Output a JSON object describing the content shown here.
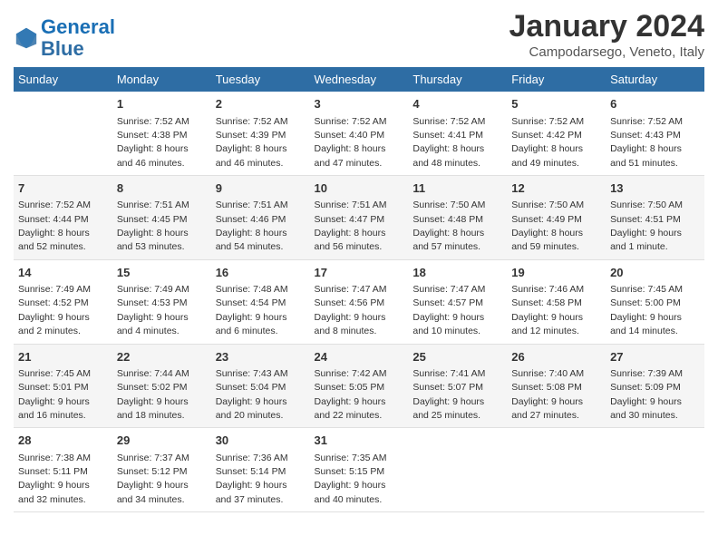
{
  "header": {
    "logo_line1": "General",
    "logo_line2": "Blue",
    "month": "January 2024",
    "location": "Campodarsego, Veneto, Italy"
  },
  "weekdays": [
    "Sunday",
    "Monday",
    "Tuesday",
    "Wednesday",
    "Thursday",
    "Friday",
    "Saturday"
  ],
  "weeks": [
    [
      {
        "day": "",
        "info": ""
      },
      {
        "day": "1",
        "info": "Sunrise: 7:52 AM\nSunset: 4:38 PM\nDaylight: 8 hours\nand 46 minutes."
      },
      {
        "day": "2",
        "info": "Sunrise: 7:52 AM\nSunset: 4:39 PM\nDaylight: 8 hours\nand 46 minutes."
      },
      {
        "day": "3",
        "info": "Sunrise: 7:52 AM\nSunset: 4:40 PM\nDaylight: 8 hours\nand 47 minutes."
      },
      {
        "day": "4",
        "info": "Sunrise: 7:52 AM\nSunset: 4:41 PM\nDaylight: 8 hours\nand 48 minutes."
      },
      {
        "day": "5",
        "info": "Sunrise: 7:52 AM\nSunset: 4:42 PM\nDaylight: 8 hours\nand 49 minutes."
      },
      {
        "day": "6",
        "info": "Sunrise: 7:52 AM\nSunset: 4:43 PM\nDaylight: 8 hours\nand 51 minutes."
      }
    ],
    [
      {
        "day": "7",
        "info": "Sunrise: 7:52 AM\nSunset: 4:44 PM\nDaylight: 8 hours\nand 52 minutes."
      },
      {
        "day": "8",
        "info": "Sunrise: 7:51 AM\nSunset: 4:45 PM\nDaylight: 8 hours\nand 53 minutes."
      },
      {
        "day": "9",
        "info": "Sunrise: 7:51 AM\nSunset: 4:46 PM\nDaylight: 8 hours\nand 54 minutes."
      },
      {
        "day": "10",
        "info": "Sunrise: 7:51 AM\nSunset: 4:47 PM\nDaylight: 8 hours\nand 56 minutes."
      },
      {
        "day": "11",
        "info": "Sunrise: 7:50 AM\nSunset: 4:48 PM\nDaylight: 8 hours\nand 57 minutes."
      },
      {
        "day": "12",
        "info": "Sunrise: 7:50 AM\nSunset: 4:49 PM\nDaylight: 8 hours\nand 59 minutes."
      },
      {
        "day": "13",
        "info": "Sunrise: 7:50 AM\nSunset: 4:51 PM\nDaylight: 9 hours\nand 1 minute."
      }
    ],
    [
      {
        "day": "14",
        "info": "Sunrise: 7:49 AM\nSunset: 4:52 PM\nDaylight: 9 hours\nand 2 minutes."
      },
      {
        "day": "15",
        "info": "Sunrise: 7:49 AM\nSunset: 4:53 PM\nDaylight: 9 hours\nand 4 minutes."
      },
      {
        "day": "16",
        "info": "Sunrise: 7:48 AM\nSunset: 4:54 PM\nDaylight: 9 hours\nand 6 minutes."
      },
      {
        "day": "17",
        "info": "Sunrise: 7:47 AM\nSunset: 4:56 PM\nDaylight: 9 hours\nand 8 minutes."
      },
      {
        "day": "18",
        "info": "Sunrise: 7:47 AM\nSunset: 4:57 PM\nDaylight: 9 hours\nand 10 minutes."
      },
      {
        "day": "19",
        "info": "Sunrise: 7:46 AM\nSunset: 4:58 PM\nDaylight: 9 hours\nand 12 minutes."
      },
      {
        "day": "20",
        "info": "Sunrise: 7:45 AM\nSunset: 5:00 PM\nDaylight: 9 hours\nand 14 minutes."
      }
    ],
    [
      {
        "day": "21",
        "info": "Sunrise: 7:45 AM\nSunset: 5:01 PM\nDaylight: 9 hours\nand 16 minutes."
      },
      {
        "day": "22",
        "info": "Sunrise: 7:44 AM\nSunset: 5:02 PM\nDaylight: 9 hours\nand 18 minutes."
      },
      {
        "day": "23",
        "info": "Sunrise: 7:43 AM\nSunset: 5:04 PM\nDaylight: 9 hours\nand 20 minutes."
      },
      {
        "day": "24",
        "info": "Sunrise: 7:42 AM\nSunset: 5:05 PM\nDaylight: 9 hours\nand 22 minutes."
      },
      {
        "day": "25",
        "info": "Sunrise: 7:41 AM\nSunset: 5:07 PM\nDaylight: 9 hours\nand 25 minutes."
      },
      {
        "day": "26",
        "info": "Sunrise: 7:40 AM\nSunset: 5:08 PM\nDaylight: 9 hours\nand 27 minutes."
      },
      {
        "day": "27",
        "info": "Sunrise: 7:39 AM\nSunset: 5:09 PM\nDaylight: 9 hours\nand 30 minutes."
      }
    ],
    [
      {
        "day": "28",
        "info": "Sunrise: 7:38 AM\nSunset: 5:11 PM\nDaylight: 9 hours\nand 32 minutes."
      },
      {
        "day": "29",
        "info": "Sunrise: 7:37 AM\nSunset: 5:12 PM\nDaylight: 9 hours\nand 34 minutes."
      },
      {
        "day": "30",
        "info": "Sunrise: 7:36 AM\nSunset: 5:14 PM\nDaylight: 9 hours\nand 37 minutes."
      },
      {
        "day": "31",
        "info": "Sunrise: 7:35 AM\nSunset: 5:15 PM\nDaylight: 9 hours\nand 40 minutes."
      },
      {
        "day": "",
        "info": ""
      },
      {
        "day": "",
        "info": ""
      },
      {
        "day": "",
        "info": ""
      }
    ]
  ]
}
